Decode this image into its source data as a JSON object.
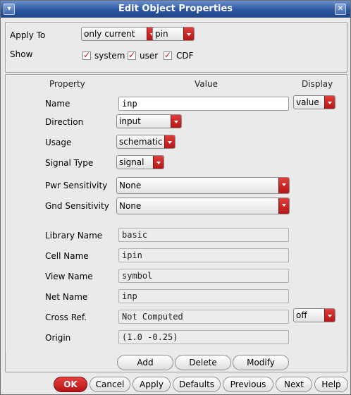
{
  "window": {
    "title": "Edit Object Properties"
  },
  "apply": {
    "label": "Apply To",
    "scope_value": "only current",
    "type_value": "pin"
  },
  "show": {
    "label": "Show",
    "options": [
      {
        "label": "system",
        "checked": true
      },
      {
        "label": "user",
        "checked": true
      },
      {
        "label": "CDF",
        "checked": true
      }
    ]
  },
  "columns": {
    "property": "Property",
    "value": "Value",
    "display": "Display"
  },
  "props": {
    "name": {
      "label": "Name",
      "value": "inp",
      "display": "value"
    },
    "direction": {
      "label": "Direction",
      "value": "input"
    },
    "usage": {
      "label": "Usage",
      "value": "schematic"
    },
    "signal_type": {
      "label": "Signal Type",
      "value": "signal"
    },
    "pwr": {
      "label": "Pwr Sensitivity",
      "value": "None"
    },
    "gnd": {
      "label": "Gnd Sensitivity",
      "value": "None"
    },
    "library": {
      "label": "Library Name",
      "value": "basic"
    },
    "cell": {
      "label": "Cell Name",
      "value": "ipin"
    },
    "view": {
      "label": "View Name",
      "value": "symbol"
    },
    "net": {
      "label": "Net Name",
      "value": "inp"
    },
    "xref": {
      "label": "Cross Ref.",
      "value": "Not Computed",
      "display": "off"
    },
    "origin": {
      "label": "Origin",
      "value": "(1.0 -0.25)"
    }
  },
  "edit_buttons": {
    "add": "Add",
    "delete": "Delete",
    "modify": "Modify"
  },
  "footer": {
    "ok": "OK",
    "cancel": "Cancel",
    "apply": "Apply",
    "defaults": "Defaults",
    "previous": "Previous",
    "next": "Next",
    "help": "Help"
  },
  "colors": {
    "accent_red": "#c41a1a",
    "title_blue": "#2b569f"
  }
}
